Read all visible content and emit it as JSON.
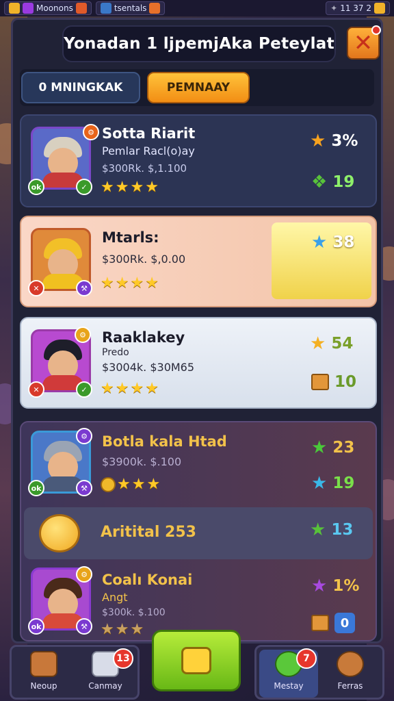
{
  "status_bar": {
    "left_label": "Moonons",
    "mid_label": "tsentals",
    "clock": "11 37 2"
  },
  "header": {
    "title": "Yonadan 1 ljpemjAka Peteylat"
  },
  "tabs": [
    {
      "label": "0 MNINGKAK"
    },
    {
      "label": "PEMNAAY"
    }
  ],
  "cards": [
    {
      "name": "Sotta Riarit",
      "subtitle": "Pemlar Racl(o)ay",
      "price": "$300Rk. $,1.100",
      "stars": 4,
      "stat_top": "3%",
      "stat_bottom": "19",
      "avatar_badge_left": "ok",
      "colors": {
        "star": "#f7a21f",
        "leaf": "#58c23a"
      }
    },
    {
      "name": "Mtarls:",
      "subtitle": "",
      "price": "$300Rk. $,0.00",
      "stars": 4,
      "stat_top": "38",
      "stat_bottom": ""
    },
    {
      "name": "Raaklakey",
      "subtitle": "Predo",
      "price": "$3004k. $30M65",
      "stars": 4,
      "stat_top": "54",
      "stat_bottom": "10"
    },
    {
      "name": "Botla kala Htad",
      "subtitle": "",
      "price": "$3900k. $.100",
      "stars": 4,
      "stat_top": "23",
      "stat_bottom": "19",
      "avatar_badge_left": "ok"
    },
    {
      "name": "Coalı Konai",
      "subtitle": "Angt",
      "price": "$300k. $.100",
      "stars": 3,
      "stat_top": "1%",
      "stat_bottom": "0"
    }
  ],
  "reward_row": {
    "label": "Aritital 253",
    "stat": "13"
  },
  "bottom_nav": {
    "items": [
      {
        "label": "Neoup",
        "badge": ""
      },
      {
        "label": "Canmay",
        "badge": "13"
      },
      {
        "label": "Mestay",
        "badge": "7"
      },
      {
        "label": "Ferras",
        "badge": ""
      }
    ]
  },
  "icons": {
    "close": "close-icon",
    "stars": "star-icon",
    "center": "search-icon"
  }
}
